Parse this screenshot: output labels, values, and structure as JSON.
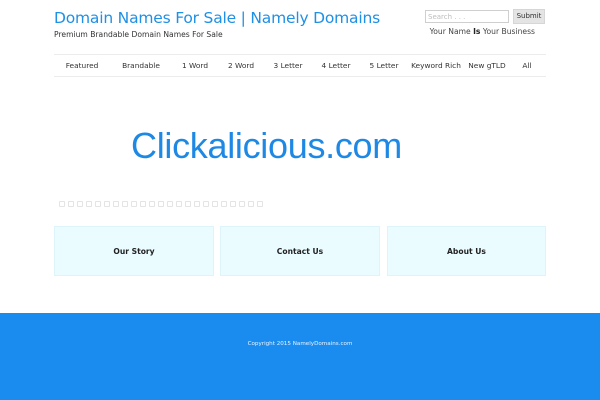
{
  "header": {
    "site_title": "Domain Names For Sale | Namely Domains",
    "tagline": "Premium Brandable Domain Names For Sale",
    "slogan_part1": "Your Name ",
    "slogan_bold": "Is",
    "slogan_part2": " Your Business"
  },
  "search": {
    "placeholder": "Search . . .",
    "submit_label": "Submit"
  },
  "nav": {
    "items": [
      {
        "label": "Featured"
      },
      {
        "label": "Brandable"
      },
      {
        "label": "1 Word"
      },
      {
        "label": "2 Word"
      },
      {
        "label": "3 Letter"
      },
      {
        "label": "4 Letter"
      },
      {
        "label": "5 Letter"
      },
      {
        "label": "Keyword Rich"
      },
      {
        "label": "New gTLD"
      },
      {
        "label": "All"
      }
    ]
  },
  "main": {
    "domain_name": "Clickalicious.com"
  },
  "boxes": [
    {
      "label": "Our Story"
    },
    {
      "label": "Contact Us"
    },
    {
      "label": "About Us"
    }
  ],
  "footer": {
    "copyright": "Copyright 2015 NamelyDomains.com"
  },
  "colors": {
    "accent": "#1e88e5",
    "footer_bg": "#1a8cf0",
    "box_bg": "#eafcff"
  }
}
